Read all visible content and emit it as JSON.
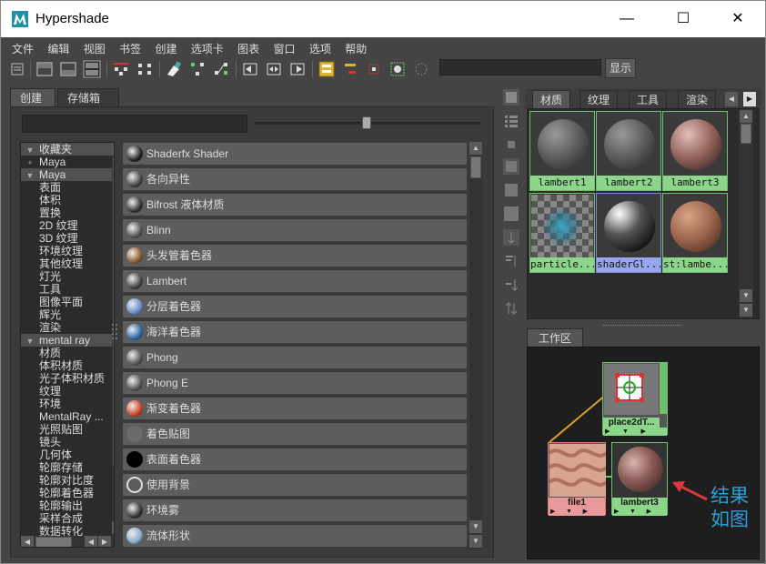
{
  "window": {
    "title": "Hypershade",
    "controls": [
      "—",
      "☐",
      "✕"
    ]
  },
  "menubar": [
    "文件",
    "编辑",
    "视图",
    "书签",
    "创建",
    "选项卡",
    "图表",
    "窗口",
    "选项",
    "帮助"
  ],
  "toolbar": {
    "show_button": "显示",
    "search_value": ""
  },
  "left_panel": {
    "tabs": [
      "创建",
      "存储箱"
    ],
    "search_value": "",
    "tree": [
      {
        "label": "收藏夹",
        "type": "head",
        "toggle": "▼"
      },
      {
        "label": "Maya",
        "type": "sub-plus",
        "toggle": "+"
      },
      {
        "label": "Maya",
        "type": "head",
        "toggle": "▼"
      },
      {
        "label": "表面",
        "type": "sub"
      },
      {
        "label": "体积",
        "type": "sub"
      },
      {
        "label": "置换",
        "type": "sub"
      },
      {
        "label": "2D 纹理",
        "type": "sub"
      },
      {
        "label": "3D 纹理",
        "type": "sub"
      },
      {
        "label": "环境纹理",
        "type": "sub"
      },
      {
        "label": "其他纹理",
        "type": "sub"
      },
      {
        "label": "灯光",
        "type": "sub"
      },
      {
        "label": "工具",
        "type": "sub"
      },
      {
        "label": "图像平面",
        "type": "sub"
      },
      {
        "label": "辉光",
        "type": "sub"
      },
      {
        "label": "渲染",
        "type": "sub"
      },
      {
        "label": "mental ray",
        "type": "head",
        "toggle": "▼"
      },
      {
        "label": "材质",
        "type": "sub"
      },
      {
        "label": "体积材质",
        "type": "sub"
      },
      {
        "label": "光子体积材质",
        "type": "sub"
      },
      {
        "label": "纹理",
        "type": "sub"
      },
      {
        "label": "环境",
        "type": "sub"
      },
      {
        "label": "MentalRay ...",
        "type": "sub"
      },
      {
        "label": "光照贴图",
        "type": "sub"
      },
      {
        "label": "镜头",
        "type": "sub"
      },
      {
        "label": "几何体",
        "type": "sub"
      },
      {
        "label": "轮廓存储",
        "type": "sub"
      },
      {
        "label": "轮廓对比度",
        "type": "sub"
      },
      {
        "label": "轮廓着色器",
        "type": "sub"
      },
      {
        "label": "轮廓输出",
        "type": "sub"
      },
      {
        "label": "采样合成",
        "type": "sub"
      },
      {
        "label": "数据转化",
        "type": "sub"
      }
    ],
    "shaders": [
      {
        "label": "Shaderfx Shader",
        "icon": "shaderfx-icon",
        "color": "#222222"
      },
      {
        "label": "各向异性",
        "icon": "anisotropic-icon",
        "color": "#444444"
      },
      {
        "label": "Bifrost 液体材质",
        "icon": "bifrost-icon",
        "color": "#333333"
      },
      {
        "label": "Blinn",
        "icon": "blinn-icon",
        "color": "#555555"
      },
      {
        "label": "头发管着色器",
        "icon": "hair-tube-icon",
        "color": "#8a5a30"
      },
      {
        "label": "Lambert",
        "icon": "lambert-icon",
        "color": "#444444"
      },
      {
        "label": "分层着色器",
        "icon": "layered-shader-icon",
        "color": "#6688cc"
      },
      {
        "label": "海洋着色器",
        "icon": "ocean-shader-icon",
        "color": "#2a6aa8"
      },
      {
        "label": "Phong",
        "icon": "phong-icon",
        "color": "#555555"
      },
      {
        "label": "Phong E",
        "icon": "phong-e-icon",
        "color": "#555555"
      },
      {
        "label": "渐变着色器",
        "icon": "ramp-shader-icon",
        "color": "#cc4422"
      },
      {
        "label": "着色贴图",
        "icon": "shading-map-icon",
        "color": "#6a6a6a"
      },
      {
        "label": "表面着色器",
        "icon": "surface-shader-icon",
        "color": "#000000"
      },
      {
        "label": "使用背景",
        "icon": "use-background-icon",
        "color": "#5d5d5d"
      },
      {
        "label": "环境雾",
        "icon": "env-fog-icon",
        "color": "#333333"
      },
      {
        "label": "流体形状",
        "icon": "fluid-shape-icon",
        "color": "#88aacc"
      }
    ]
  },
  "material_panel": {
    "tabs": [
      "材质",
      "纹理",
      "工具",
      "渲染"
    ],
    "materials": [
      {
        "label": "lambert1",
        "kind": "gray",
        "selected": false
      },
      {
        "label": "lambert2",
        "kind": "gray",
        "selected": false
      },
      {
        "label": "lambert3",
        "kind": "skin",
        "selected": false
      },
      {
        "label": "particle...",
        "kind": "particle",
        "selected": false
      },
      {
        "label": "shaderGl...",
        "kind": "glass",
        "selected": true
      },
      {
        "label": "st:lambe...",
        "kind": "brown",
        "selected": false
      }
    ]
  },
  "work_area": {
    "tab": "工作区",
    "nodes": {
      "place2d": "place2dT...",
      "file": "file1",
      "lambert": "lambert3"
    }
  },
  "annotation": {
    "line1": "结果",
    "line2": "如图",
    "color": "#2aa0d8"
  }
}
